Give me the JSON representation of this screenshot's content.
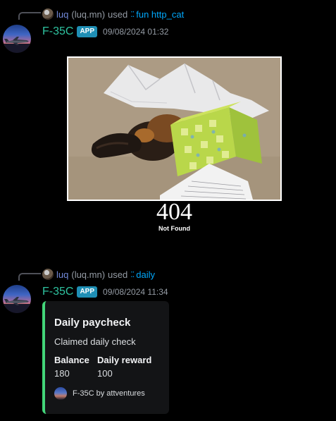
{
  "message1": {
    "reply": {
      "user": "luq",
      "handle": "(luq.mn)",
      "used": "used",
      "command": "fun http_cat"
    },
    "author": "F-35C",
    "badge": "APP",
    "timestamp": "09/08/2024 01:32",
    "image": {
      "code": "404",
      "text": "Not Found"
    }
  },
  "message2": {
    "reply": {
      "user": "luq",
      "handle": "(luq.mn)",
      "used": "used",
      "command": "daily"
    },
    "author": "F-35C",
    "badge": "APP",
    "timestamp": "09/08/2024 11:34",
    "embed": {
      "accent_color": "#43d67a",
      "title": "Daily paycheck",
      "description": "Claimed daily check",
      "fields": [
        {
          "name": "Balance",
          "value": "180"
        },
        {
          "name": "Daily reward",
          "value": "100"
        }
      ],
      "footer": "F-35C by attventures"
    }
  },
  "icons": {
    "command": "slash-command-icon",
    "avatar": "fighter-jet-avatar"
  },
  "colors": {
    "background": "#000000",
    "command_link": "#00a8fc",
    "bot_name": "#2ec3a0",
    "badge": "#1f8fb5"
  }
}
